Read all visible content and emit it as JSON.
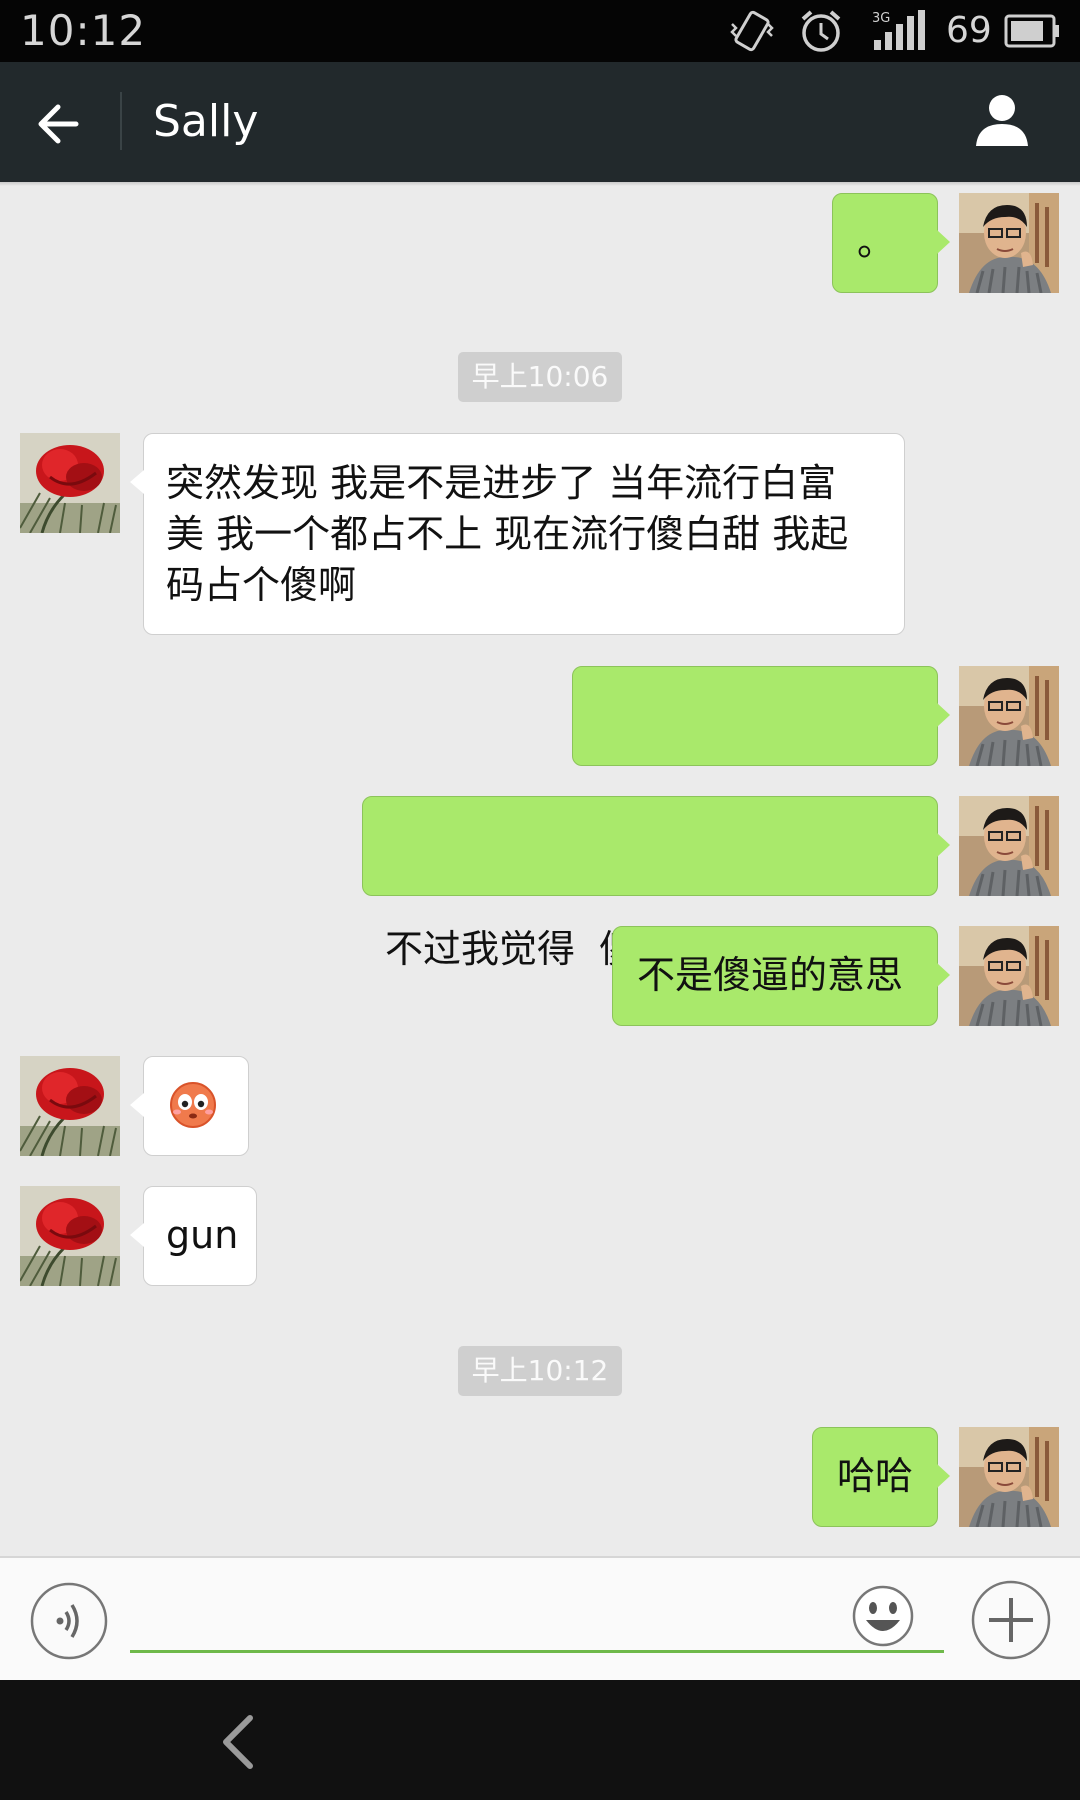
{
  "status_bar": {
    "time": "10:12",
    "signal_type": "3G",
    "battery": "69"
  },
  "header": {
    "title": "Sally",
    "back_icon": "arrow-left-icon",
    "profile_icon": "person-icon"
  },
  "messages": [
    {
      "type": "text",
      "from": "me",
      "text": "。"
    },
    {
      "type": "time",
      "text": "早上10:06"
    },
    {
      "type": "text",
      "from": "her",
      "lines": [
        "突然发现 我是不是进步了 当年流行白富",
        "美 我一个都占不上 现在流行傻白甜 我起",
        "码占个傻啊"
      ]
    },
    {
      "type": "text",
      "from": "me",
      "text": "。 。 。 。 。 。 。 。"
    },
    {
      "type": "text",
      "from": "me",
      "text": "不过我觉得  傻   是呆萌的意思"
    },
    {
      "type": "text",
      "from": "me",
      "text": "不是傻逼的意思"
    },
    {
      "type": "emoji",
      "from": "her",
      "emoji": "flushed-face-emoji"
    },
    {
      "type": "text",
      "from": "her",
      "text": "gun"
    },
    {
      "type": "time",
      "text": "早上10:12"
    },
    {
      "type": "text",
      "from": "me",
      "text": "哈哈"
    }
  ],
  "input_bar": {
    "placeholder": "",
    "value": "",
    "voice_icon": "voice-icon",
    "emoji_icon": "smiley-icon",
    "plus_icon": "plus-icon"
  },
  "colors": {
    "my_bubble": "#a9e96b",
    "her_bubble": "#ffffff",
    "header_bg": "#22292c",
    "accent": "#6fb94a"
  }
}
